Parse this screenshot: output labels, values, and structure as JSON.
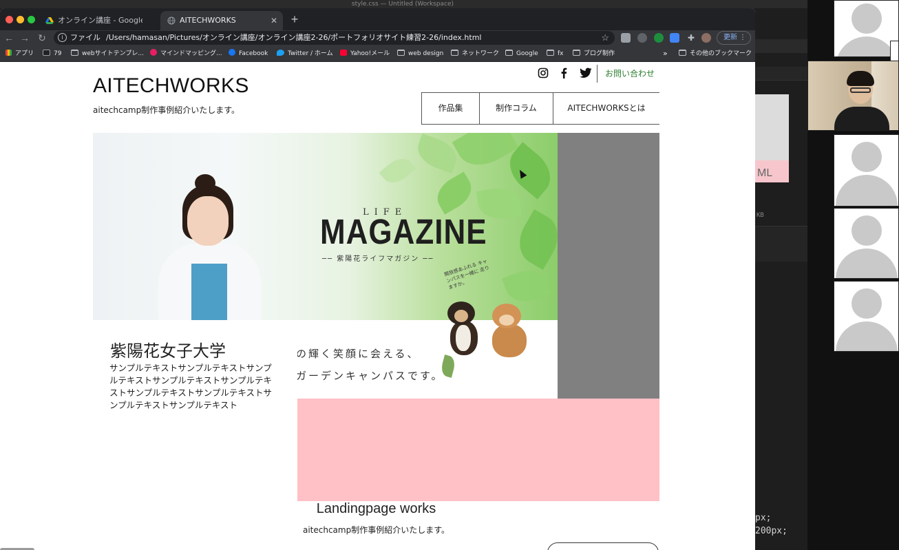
{
  "os": {
    "window_title": "style.css — Untitled (Workspace)"
  },
  "browser": {
    "tabs": [
      {
        "label": "オンライン講座 - Google ドライブ",
        "active": false
      },
      {
        "label": "AITECHWORKS",
        "active": true
      }
    ],
    "omnibox": {
      "scheme": "ファイル",
      "url": "/Users/hamasan/Pictures/オンライン講座/オンライン講座2-26/ポートフォリオサイト練習2-26/index.html"
    },
    "update_label": "更新",
    "bookmarks": [
      {
        "label": "アプリ",
        "icon": "apps-grid-icon"
      },
      {
        "label": "79",
        "icon": "st-icon"
      },
      {
        "label": "webサイトテンプレ...",
        "icon": "folder-icon"
      },
      {
        "label": "マインドマッピング...",
        "icon": "mindmap-icon"
      },
      {
        "label": "Facebook",
        "icon": "facebook-icon"
      },
      {
        "label": "Twitter / ホーム",
        "icon": "twitter-icon"
      },
      {
        "label": "Yahoo!メール",
        "icon": "yahoo-icon"
      },
      {
        "label": "web design",
        "icon": "folder-icon"
      },
      {
        "label": "ネットワーク",
        "icon": "folder-icon"
      },
      {
        "label": "Google",
        "icon": "folder-icon"
      },
      {
        "label": "fx",
        "icon": "folder-icon"
      },
      {
        "label": "ブログ制作",
        "icon": "folder-icon"
      }
    ],
    "bookmarks_overflow": "»",
    "other_bookmarks": "その他のブックマーク"
  },
  "site": {
    "title": "AITECHWORKS",
    "subtitle": "aitechcamp制作事例紹介いたします。",
    "contact": "お問い合わせ",
    "nav": [
      "作品集",
      "制作コラム",
      "AITECHWORKSとは"
    ],
    "hero": {
      "life": "LIFE",
      "magazine": "MAGAZINE",
      "magazine_sub": "── 紫陽花ライフマガジン ──",
      "note": "開放感あふれる キャンパスを一緒に 走りますか。",
      "line1": "の輝く笑顔に会える、",
      "line2": "ガーデンキャンパスです。"
    },
    "university": {
      "title": "紫陽花女子大学",
      "text": "サンプルテキストサンプルテキストサンプルテキストサンプルテキストサンプルテキストサンプルテキストサンプルテキストサンプルテキストサンプルテキスト"
    },
    "landing": {
      "title": "Landingpage works",
      "subtitle": "aitechcamp制作事例紹介いたします。"
    }
  },
  "editor": {
    "thumb_text": "ML",
    "size_text": "KB",
    "code_line1": "px;",
    "code_line2": "200px;"
  },
  "colors": {
    "pink": "#ffc0c6",
    "gray": "#808080",
    "contact_green": "#2e7d32",
    "update_blue": "#8ab4f8"
  }
}
